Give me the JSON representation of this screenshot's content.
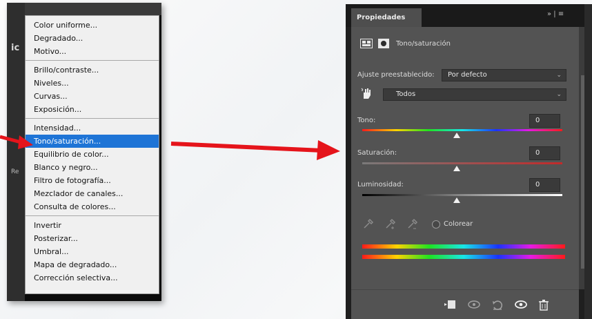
{
  "menu": {
    "groups": [
      {
        "items": [
          {
            "label": "Color uniforme..."
          },
          {
            "label": "Degradado..."
          },
          {
            "label": "Motivo..."
          }
        ]
      },
      {
        "items": [
          {
            "label": "Brillo/contraste..."
          },
          {
            "label": "Niveles..."
          },
          {
            "label": "Curvas..."
          },
          {
            "label": "Exposición..."
          }
        ]
      },
      {
        "items": [
          {
            "label": "Intensidad..."
          },
          {
            "label": "Tono/saturación...",
            "selected": true
          },
          {
            "label": "Equilibrio de color..."
          },
          {
            "label": "Blanco y negro..."
          },
          {
            "label": "Filtro de fotografía..."
          },
          {
            "label": "Mezclador de canales..."
          },
          {
            "label": "Consulta de colores..."
          }
        ]
      },
      {
        "items": [
          {
            "label": "Invertir"
          },
          {
            "label": "Posterizar..."
          },
          {
            "label": "Umbral..."
          },
          {
            "label": "Mapa de degradado..."
          },
          {
            "label": "Corrección selectiva..."
          }
        ]
      }
    ],
    "bg_glyphs": [
      "ic",
      "Re"
    ]
  },
  "arrow_color": "#e5141b",
  "properties": {
    "tab_title": "Propiedades",
    "tab_controls": "»  |  ≡",
    "header_title": "Tono/saturación",
    "preset_label": "Ajuste preestablecido:",
    "preset_value": "Por defecto",
    "channel_value": "Todos",
    "hue_label": "Tono:",
    "hue_value": "0",
    "saturation_label": "Saturación:",
    "saturation_value": "0",
    "lightness_label": "Luminosidad:",
    "lightness_value": "0",
    "colorize_label": "Colorear",
    "colors": {
      "panel_bg": "#535353",
      "selection_blue": "#1e74d6"
    },
    "bottom_icons": [
      "clip-to-layer-icon",
      "view-previous-state-icon",
      "reset-icon",
      "visibility-eye-icon",
      "delete-icon"
    ]
  }
}
